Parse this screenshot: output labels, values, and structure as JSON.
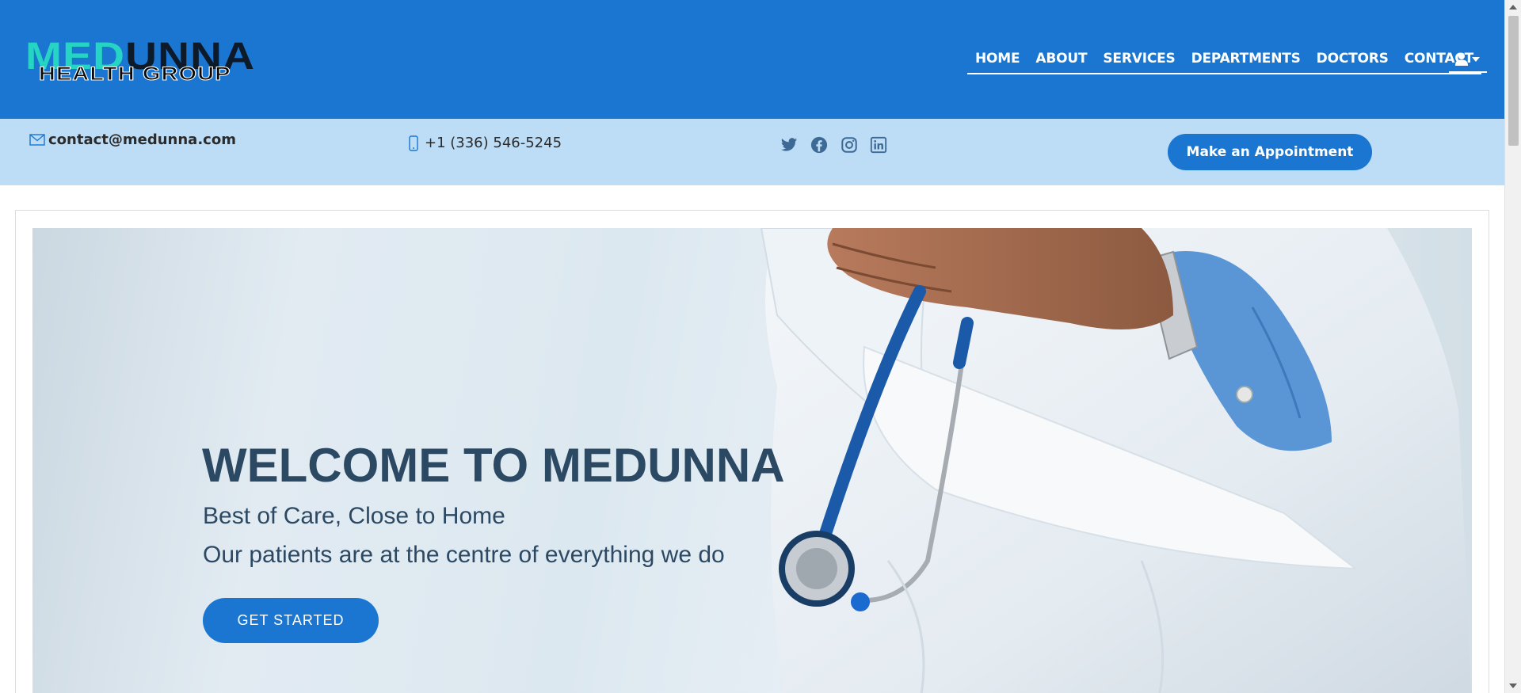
{
  "brand": {
    "logo_part1": "MED",
    "logo_part2": "UNNA",
    "logo_subtitle": "HEALTH GROUP"
  },
  "nav": {
    "items": [
      {
        "label": "HOME"
      },
      {
        "label": "ABOUT"
      },
      {
        "label": "SERVICES"
      },
      {
        "label": "DEPARTMENTS"
      },
      {
        "label": "DOCTORS"
      },
      {
        "label": "CONTACT"
      }
    ],
    "user_icon": "user-icon"
  },
  "topbar": {
    "email": "contact@medunna.com",
    "phone": "+1 (336) 546-5245",
    "social": [
      "twitter-icon",
      "facebook-icon",
      "instagram-icon",
      "linkedin-icon"
    ],
    "appointment_label": "Make an Appointment"
  },
  "hero": {
    "title": "WELCOME TO MEDUNNA",
    "subtitle1": "Best of Care, Close to Home",
    "subtitle2": "Our patients are at the centre of everything we do",
    "cta_label": "GET STARTED"
  },
  "colors": {
    "primary": "#1a76d1",
    "topbar_bg": "#bddcf6",
    "heading": "#2c4964",
    "logo_accent": "#26d4c4"
  }
}
